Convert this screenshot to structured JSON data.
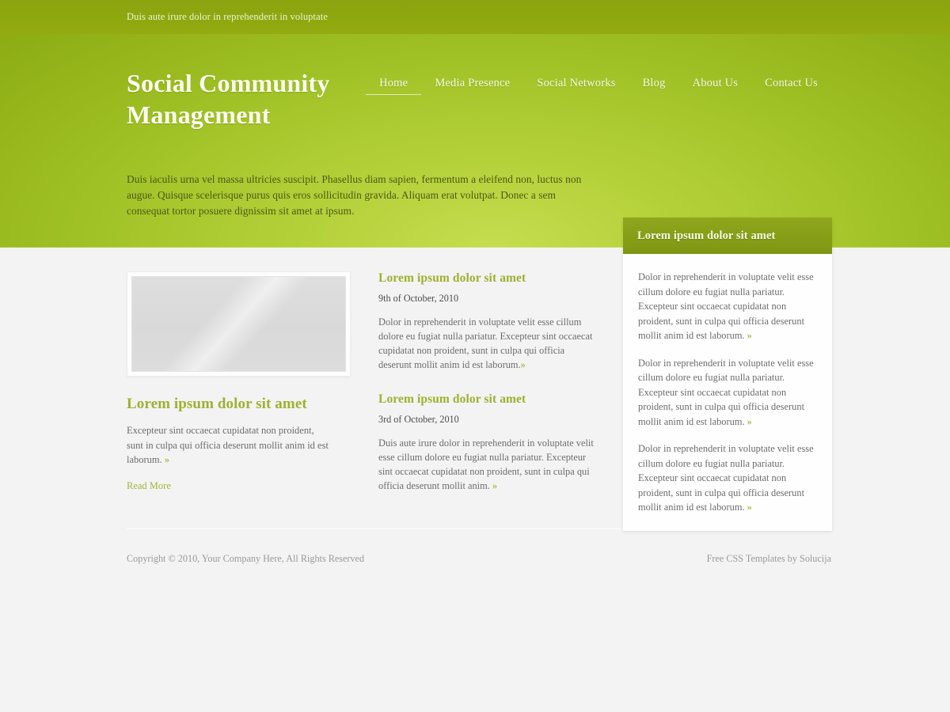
{
  "topbar": {
    "tagline": "Duis aute irure dolor in reprehenderit in voluptate"
  },
  "header": {
    "site_title": "Social Community Management",
    "nav": [
      {
        "label": "Home",
        "active": true
      },
      {
        "label": "Media Presence",
        "active": false
      },
      {
        "label": "Social Networks",
        "active": false
      },
      {
        "label": "Blog",
        "active": false
      },
      {
        "label": "About Us",
        "active": false
      },
      {
        "label": "Contact Us",
        "active": false
      }
    ],
    "intro": "Duis iaculis urna vel massa ultricies suscipit. Phasellus diam sapien, fermentum a eleifend non, luctus non augue. Quisque scelerisque purus quis eros sollicitudin gravida. Aliquam erat volutpat. Donec a sem consequat tortor posuere dignissim sit amet at ipsum."
  },
  "sidebar": {
    "title": "Lorem ipsum dolor sit amet",
    "paragraphs": [
      "Dolor in reprehenderit in voluptate velit esse cillum dolore eu fugiat nulla pariatur. Excepteur sint occaecat cupidatat non proident, sunt in culpa qui officia deserunt mollit anim id est laborum.",
      "Dolor in reprehenderit in voluptate velit esse cillum dolore eu fugiat nulla pariatur. Excepteur sint occaecat cupidatat non proident, sunt in culpa qui officia deserunt mollit anim id est laborum.",
      "Dolor in reprehenderit in voluptate velit esse cillum dolore eu fugiat nulla pariatur. Excepteur sint occaecat cupidatat non proident, sunt in culpa qui officia deserunt mollit anim id est laborum."
    ],
    "more_marker": "»"
  },
  "left_column": {
    "image_alt": "image-placeholder",
    "heading": "Lorem ipsum dolor sit amet",
    "body": "Excepteur sint occaecat cupidatat non proident, sunt in culpa qui officia deserunt mollit anim id est laborum.",
    "more_marker": "»",
    "read_more": "Read More"
  },
  "articles": [
    {
      "heading": "Lorem ipsum dolor sit amet",
      "date": "9th of October, 2010",
      "body": "Dolor in reprehenderit in voluptate velit esse cillum dolore eu fugiat nulla pariatur. Excepteur sint occaecat cupidatat non proident, sunt in culpa qui officia deserunt mollit anim id est laborum.",
      "more_marker": "»"
    },
    {
      "heading": "Lorem ipsum dolor sit amet",
      "date": "3rd of October, 2010",
      "body": "Duis aute irure dolor in reprehenderit in voluptate velit esse cillum dolore eu fugiat nulla pariatur. Excepteur sint occaecat cupidatat non proident, sunt in culpa qui officia deserunt mollit anim.",
      "more_marker": "»"
    }
  ],
  "footer": {
    "copyright": "Copyright © 2010, Your Company Here, All Rights Reserved",
    "credit": "Free CSS Templates by Solucija"
  },
  "colors": {
    "topbar_green": "#8ba40f",
    "header_green_light": "#c5dd4f",
    "header_green_dark": "#8aa912",
    "accent_heading": "#9fb02f",
    "sidebar_header": "#869e17",
    "page_bg": "#f3f3f3",
    "body_text": "#6d6d6d"
  }
}
